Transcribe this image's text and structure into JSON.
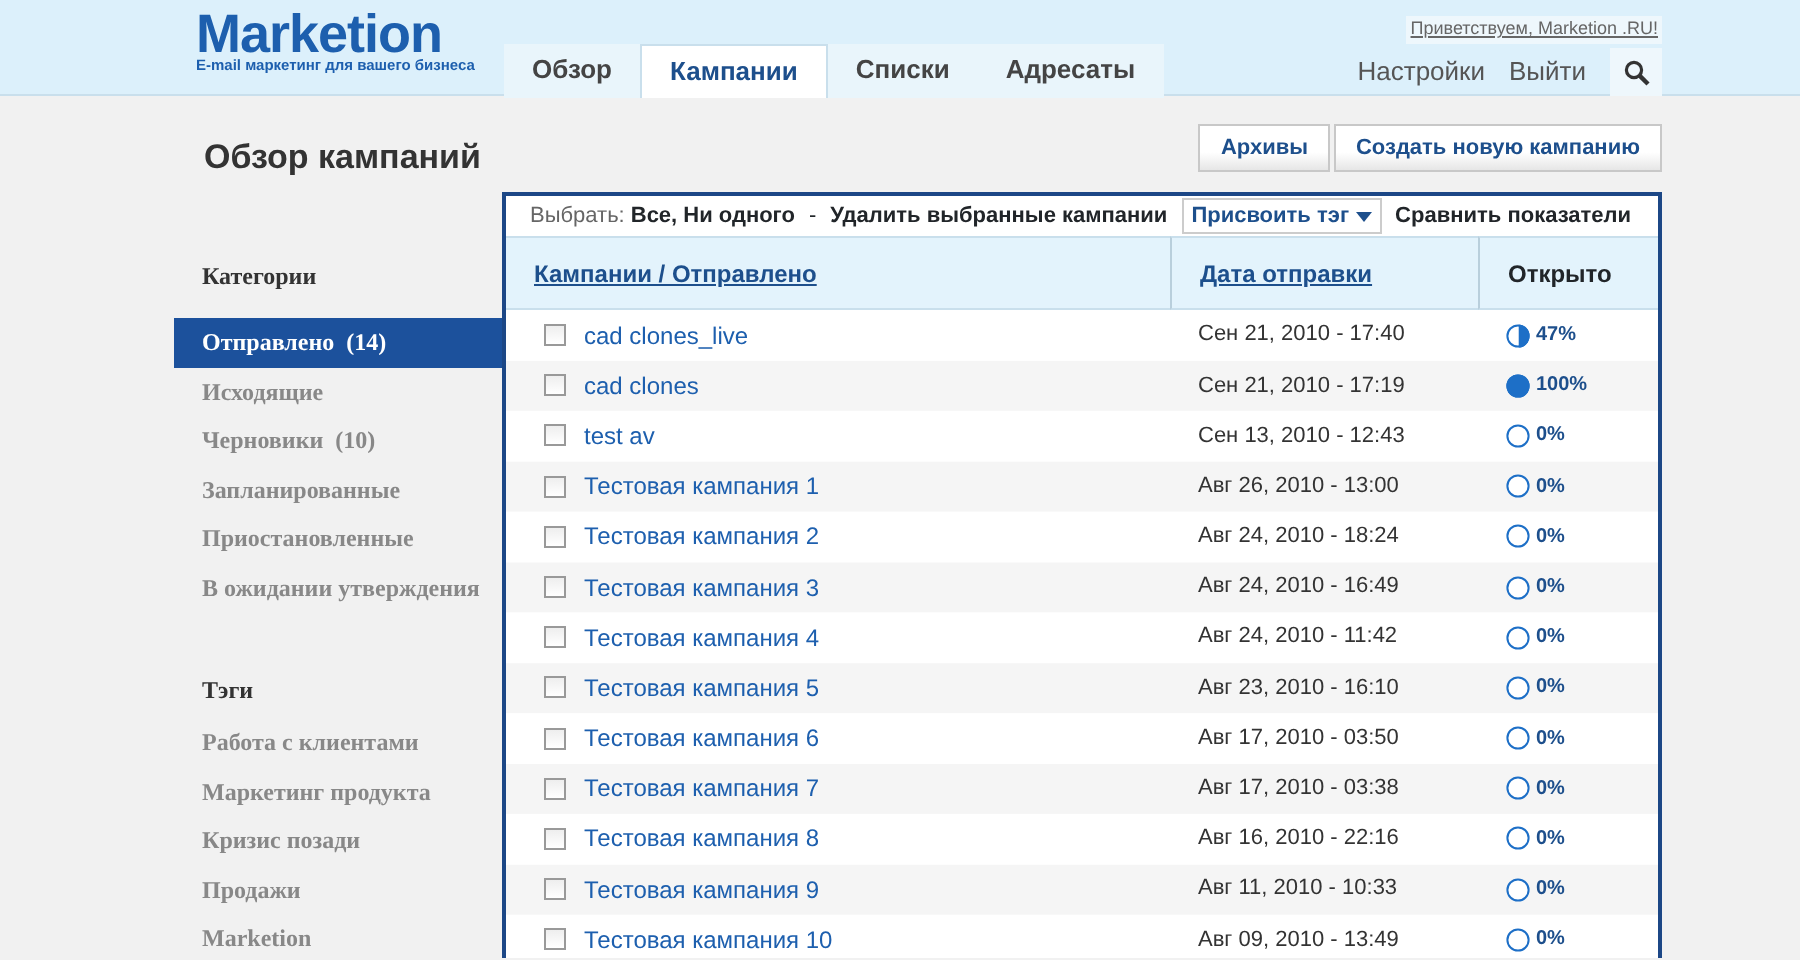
{
  "logo": {
    "name": "Marketion",
    "tagline": "E-mail маркетинг для вашего бизнеса"
  },
  "tabs": [
    {
      "label": "Обзор",
      "selected": false
    },
    {
      "label": "Кампании",
      "selected": true
    },
    {
      "label": "Списки",
      "selected": false
    },
    {
      "label": "Адресаты",
      "selected": false
    }
  ],
  "greeting": "Приветствуем, Marketion .RU!",
  "top_links": [
    "Настройки",
    "Выйти"
  ],
  "page_title": "Обзор кампаний",
  "buttons": [
    "Архивы",
    "Создать новую кампанию"
  ],
  "sidebar": {
    "categories_title": "Категории",
    "categories": [
      {
        "label": "Отправлено",
        "count": "(14)",
        "selected": true
      },
      {
        "label": "Исходящие",
        "selected": false
      },
      {
        "label": "Черновики",
        "count": "(10)",
        "selected": false
      },
      {
        "label": "Запланированные",
        "selected": false
      },
      {
        "label": "Приостановленные",
        "selected": false
      },
      {
        "label": "В ожидании утверждения",
        "selected": false
      }
    ],
    "tags_title": "Тэги",
    "tags": [
      "Работа с клиентами",
      "Маркетинг продукта",
      "Кризис позади",
      "Продажи",
      "Marketion"
    ]
  },
  "toolbar": {
    "select_label": "Выбрать:",
    "select_all": "Все,",
    "select_none": "Ни одного",
    "separator": "-",
    "delete": "Удалить выбранные кампании",
    "assign_tag": "Присвоить тэг",
    "compare": "Сравнить показатели"
  },
  "table": {
    "columns": [
      "Кампании / Отправлено",
      "Дата отправки",
      "Открыто"
    ],
    "rows": [
      {
        "name": "cad clones_live",
        "date": "Сен 21, 2010 - 17:40",
        "opened": "47%",
        "level": 0.47,
        "checked": false
      },
      {
        "name": "cad clones",
        "date": "Сен 21, 2010 - 17:19",
        "opened": "100%",
        "level": 1,
        "checked": false
      },
      {
        "name": "test av",
        "date": "Сен 13, 2010 - 12:43",
        "opened": "0%",
        "level": 0,
        "checked": false
      },
      {
        "name": "Тестовая кампания 1",
        "date": "Авг 26, 2010 - 13:00",
        "opened": "0%",
        "level": 0,
        "checked": false
      },
      {
        "name": "Тестовая кампания 2",
        "date": "Авг 24, 2010 - 18:24",
        "opened": "0%",
        "level": 0,
        "checked": false
      },
      {
        "name": "Тестовая кампания 3",
        "date": "Авг 24, 2010 - 16:49",
        "opened": "0%",
        "level": 0,
        "checked": false
      },
      {
        "name": "Тестовая кампания 4",
        "date": "Авг 24, 2010 - 11:42",
        "opened": "0%",
        "level": 0,
        "checked": false
      },
      {
        "name": "Тестовая кампания 5",
        "date": "Авг 23, 2010 - 16:10",
        "opened": "0%",
        "level": 0,
        "checked": false
      },
      {
        "name": "Тестовая кампания 6",
        "date": "Авг 17, 2010 - 03:50",
        "opened": "0%",
        "level": 0,
        "checked": false
      },
      {
        "name": "Тестовая кампания 7",
        "date": "Авг 17, 2010 - 03:38",
        "opened": "0%",
        "level": 0,
        "checked": false
      },
      {
        "name": "Тестовая кампания 8",
        "date": "Авг 16, 2010 - 22:16",
        "opened": "0%",
        "level": 0,
        "checked": false
      },
      {
        "name": "Тестовая кампания 9",
        "date": "Авг 11, 2010 - 10:33",
        "opened": "0%",
        "level": 0,
        "checked": false
      },
      {
        "name": "Тестовая кампания 10",
        "date": "Авг 09, 2010 - 13:49",
        "opened": "0%",
        "level": 0,
        "checked": false
      }
    ]
  }
}
